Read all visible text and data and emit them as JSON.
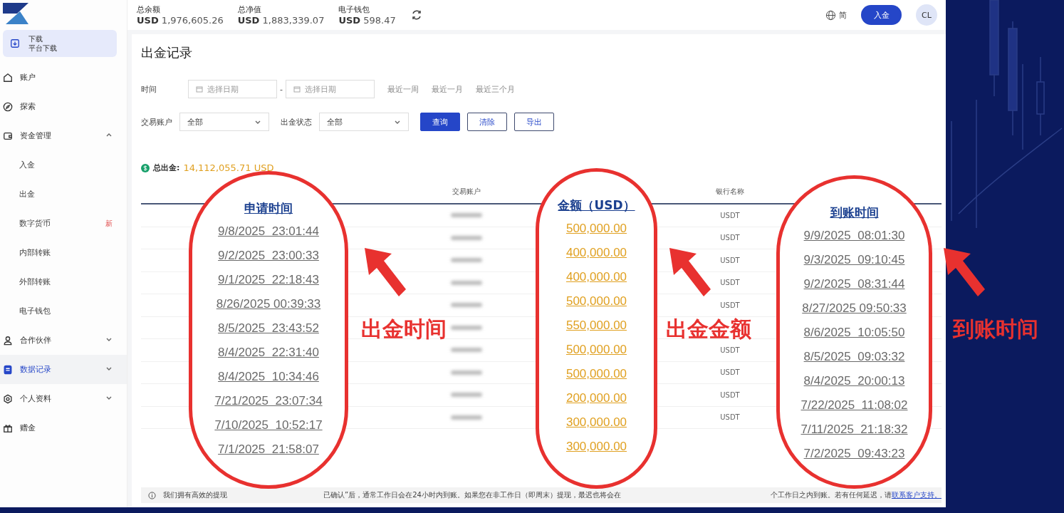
{
  "sidebar": {
    "download": {
      "line1": "下载",
      "line2": "平台下载"
    },
    "items": [
      {
        "kind": "link",
        "label": "账户",
        "selected": false
      },
      {
        "kind": "link",
        "label": "探索",
        "selected": false
      },
      {
        "kind": "group",
        "label": "资金管理",
        "selected": false,
        "expanded": true,
        "children": [
          {
            "label": "入金"
          },
          {
            "label": "出金"
          },
          {
            "label": "数字货币",
            "badge": "新"
          },
          {
            "label": "内部转账"
          },
          {
            "label": "外部转账"
          },
          {
            "label": "电子钱包"
          }
        ]
      },
      {
        "kind": "group",
        "label": "合作伙伴",
        "selected": false,
        "expanded": false
      },
      {
        "kind": "group",
        "label": "数据记录",
        "selected": true,
        "expanded": false
      },
      {
        "kind": "group",
        "label": "个人资料",
        "selected": false,
        "expanded": false
      },
      {
        "kind": "link",
        "label": "赠金",
        "selected": false
      }
    ]
  },
  "topbar": {
    "stats": [
      {
        "label": "总余额",
        "currency": "USD",
        "value": "1,976,605.26"
      },
      {
        "label": "总净值",
        "currency": "USD",
        "value": "1,883,339.07"
      },
      {
        "label": "电子钱包",
        "currency": "USD",
        "value": "598.47"
      }
    ],
    "language": "简",
    "deposit_button": "入金",
    "avatar": "CL"
  },
  "page": {
    "title": "出金记录",
    "filters": {
      "time_label": "时间",
      "start_placeholder": "选择日期",
      "separator": "-",
      "end_placeholder": "选择日期",
      "quick": [
        "最近一周",
        "最近一月",
        "最近三个月"
      ],
      "account_label": "交易账户",
      "account_value": "全部",
      "status_label": "出金状态",
      "status_value": "全部",
      "buttons": [
        {
          "label": "查询",
          "kind": "primary"
        },
        {
          "label": "清除",
          "kind": "outline"
        },
        {
          "label": "导出",
          "kind": "outline"
        }
      ]
    },
    "total": {
      "label": "总出金:",
      "value": "14,112,055.71 USD"
    },
    "table": {
      "columns": [
        "交易账户",
        "银行名称"
      ],
      "rows": [
        {
          "bank": "USDT"
        },
        {
          "bank": "USDT"
        },
        {
          "bank": "USDT"
        },
        {
          "bank": "USDT"
        },
        {
          "bank": "USDT"
        },
        {},
        {
          "bank": "USDT"
        },
        {
          "bank": "USDT"
        },
        {
          "bank": "USDT"
        },
        {
          "bank": "USDT"
        }
      ]
    },
    "notice": {
      "parts": [
        "我们拥有高效的提现",
        "已确认”后，通常工作日会在24小时内到账。如果您在非工作日（即周末）提现，最迟也将会在",
        "个工作日之内到账。若有任何延迟，请"
      ],
      "link": "联系客户支持。"
    }
  },
  "annotations": {
    "callouts": [
      {
        "header": "申请时间",
        "kind": "time",
        "values": [
          "9/8/2025  23:01:44",
          "9/2/2025  23:00:33",
          "9/1/2025  22:18:43",
          "8/26/2025 00:39:33",
          "8/5/2025  23:43:52",
          "8/4/2025  22:31:40",
          "8/4/2025  10:34:46",
          "7/21/2025  23:07:34",
          "7/10/2025  10:52:17",
          "7/1/2025  21:58:07"
        ],
        "label": "出金时间"
      },
      {
        "header": "金额（USD）",
        "kind": "amount",
        "values": [
          "500,000.00",
          "400,000.00",
          "400,000.00",
          "500,000.00",
          "550,000.00",
          "500,000.00",
          "500,000.00",
          "200,000.00",
          "300,000.00",
          "300,000.00"
        ],
        "label": "出金金额"
      },
      {
        "header": "到账时间",
        "kind": "time",
        "values": [
          "9/9/2025  08:01:30",
          "9/3/2025  09:10:45",
          "9/2/2025  08:31:44",
          "8/27/2025 09:50:33",
          "8/6/2025  10:05:50",
          "8/5/2025  09:03:32",
          "8/4/2025  20:00:13",
          "7/22/2025  11:08:02",
          "7/11/2025  21:18:32",
          "7/2/2025  09:43:23"
        ],
        "label": "到账时间"
      }
    ]
  }
}
